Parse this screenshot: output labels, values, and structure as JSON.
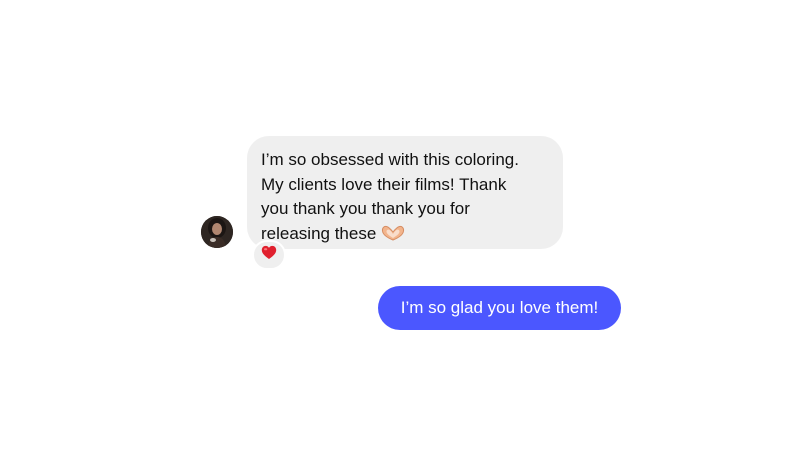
{
  "conversation": {
    "incoming": {
      "lines": [
        "I’m so obsessed with this coloring.",
        "My clients love their films! Thank",
        "you thank you thank you for",
        "releasing these"
      ],
      "trailing_emoji": "heart-hands-emoji",
      "reaction": "red-heart-emoji",
      "avatar": "user-avatar-photo"
    },
    "outgoing": {
      "text": "I’m so glad you love them!"
    }
  },
  "colors": {
    "incoming_bubble": "#efefef",
    "outgoing_bubble": "#4b57ff",
    "outgoing_text": "#ffffff",
    "incoming_text": "#111111",
    "reaction_heart": "#e0202e"
  }
}
